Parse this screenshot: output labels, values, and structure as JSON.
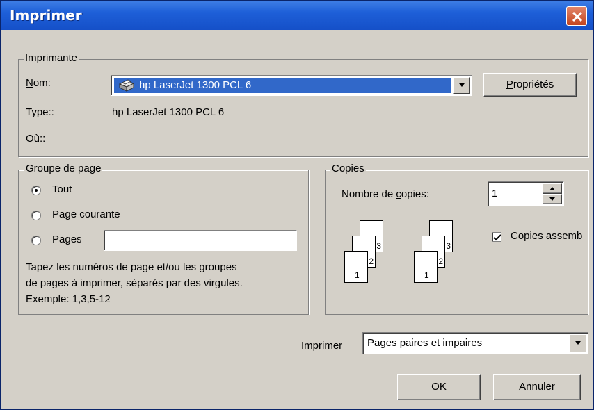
{
  "window": {
    "title": "Imprimer"
  },
  "printer": {
    "legend": "Imprimante",
    "name_label_pre": "",
    "name_label_ul": "N",
    "name_label_post": "om:",
    "selected_printer": "hp LaserJet 1300 PCL 6",
    "printer_icon": "printer-icon",
    "properties_ul": "P",
    "properties_post": "ropriétés",
    "type_label": "Type::",
    "type_value": "hp LaserJet 1300 PCL 6",
    "where_label": "Où::"
  },
  "page_range": {
    "legend": "Groupe de page",
    "options": [
      {
        "label": "Tout",
        "checked": true
      },
      {
        "label": "Page courante",
        "checked": false
      },
      {
        "label": "Pages",
        "checked": false
      }
    ],
    "pages_value": "",
    "help_lines": [
      "Tapez les numéros de page et/ou les groupes",
      "de pages à imprimer, séparés par des virgules.",
      "Exemple: 1,3,5-12"
    ]
  },
  "copies": {
    "legend": "Copies",
    "count_label_pre": "Nombre de ",
    "count_label_ul": "c",
    "count_label_post": "opies:",
    "count_value": "1",
    "collate_checked": true,
    "collate_label_pre": "Copies ",
    "collate_label_ul": "a",
    "collate_label_post": "ssemb",
    "stack_pages": [
      "1",
      "2",
      "3"
    ]
  },
  "print_what": {
    "label_pre": "Imp",
    "label_ul": "r",
    "label_post": "imer",
    "selected": "Pages paires et impaires"
  },
  "buttons": {
    "ok": "OK",
    "cancel": "Annuler"
  }
}
